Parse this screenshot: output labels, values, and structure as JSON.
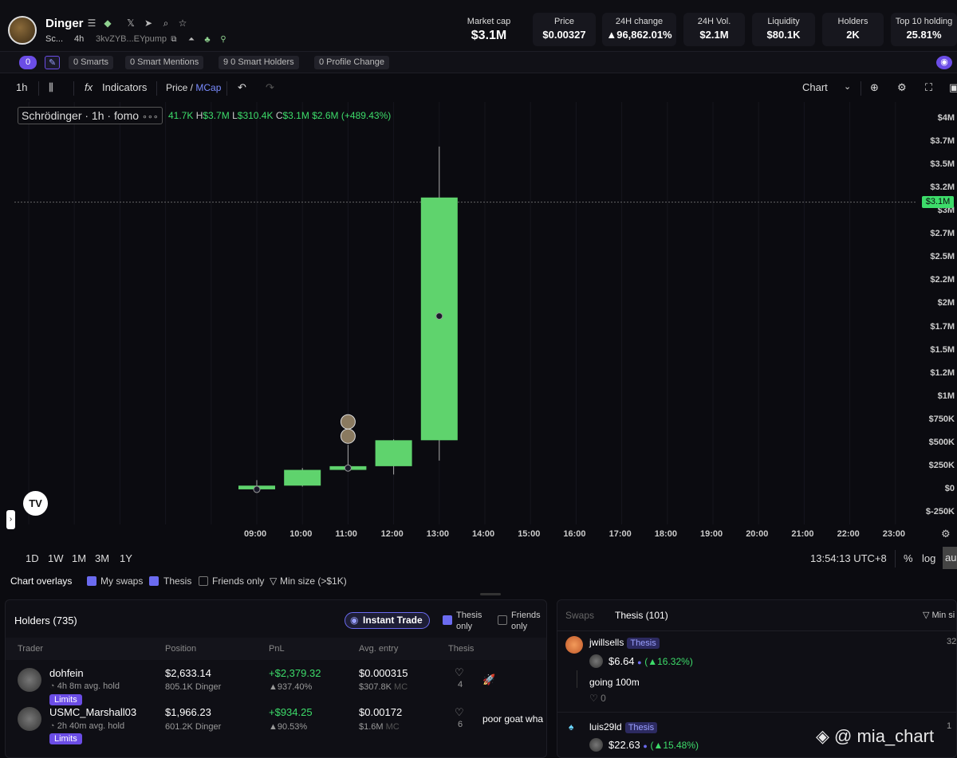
{
  "token": {
    "name": "Dinger",
    "symbol_short": "Sc...",
    "age": "4h",
    "address": "3kvZYB...EYpump"
  },
  "stats": [
    {
      "label": "Market cap",
      "value": "$3.1M"
    },
    {
      "label": "Price",
      "value": "$0.00327"
    },
    {
      "label": "24H change",
      "value": "▲96,862.01%"
    },
    {
      "label": "24H Vol.",
      "value": "$2.1M"
    },
    {
      "label": "Liquidity",
      "value": "$80.1K"
    },
    {
      "label": "Holders",
      "value": "2K"
    },
    {
      "label": "Top 10 holding",
      "value": "25.81%"
    }
  ],
  "filter_chips": {
    "count0": "0",
    "smarts": "0  Smarts",
    "smart_mentions": "0  Smart Mentions",
    "smart_holders": "9 0  Smart Holders",
    "profile_change": "0  Profile Change"
  },
  "toolbar": {
    "interval": "1h",
    "indicators": "Indicators",
    "price": "Price",
    "slash": " / ",
    "mcap": "MCap",
    "chart_type": "Chart"
  },
  "legend": {
    "title": "Schrödinger · 1h · fomo",
    "dots": "∘∘∘",
    "open": "41.7K",
    "h_label": "H",
    "high": "$3.7M",
    "l_label": "L",
    "low": "$310.4K",
    "c_label": "C",
    "close": "$3.1M",
    "change": "$2.6M (+489.43%)"
  },
  "chart_data": {
    "type": "candlestick",
    "x": [
      "09:00",
      "10:00",
      "11:00",
      "12:00",
      "13:00",
      "14:00",
      "15:00",
      "16:00",
      "17:00",
      "18:00",
      "19:00",
      "20:00",
      "21:00",
      "22:00",
      "23:00"
    ],
    "yticks": [
      "$4M",
      "$3.7M",
      "$3.5M",
      "$3.2M",
      "$3M",
      "$2.7M",
      "$2.5M",
      "$2.2M",
      "$2M",
      "$1.7M",
      "$1.5M",
      "$1.2M",
      "$1M",
      "$750K",
      "$500K",
      "$250K",
      "$0",
      "$-250K"
    ],
    "ylim": [
      -250000,
      4000000
    ],
    "candles": [
      {
        "t": "09:00",
        "open": 0,
        "close": 40000,
        "high": 100000,
        "low": -10000
      },
      {
        "t": "10:00",
        "open": 40000,
        "close": 210000,
        "high": 230000,
        "low": 30000
      },
      {
        "t": "11:00",
        "open": 210000,
        "close": 250000,
        "high": 480000,
        "low": 200000
      },
      {
        "t": "12:00",
        "open": 250000,
        "close": 530000,
        "high": 540000,
        "low": 160000
      },
      {
        "t": "13:00",
        "open": 530000,
        "close": 3150000,
        "high": 3700000,
        "low": 310400
      }
    ],
    "current_price": "$3.1M",
    "current_value": 3100000
  },
  "chart_footer": {
    "ranges": [
      "1D",
      "1W",
      "1M",
      "3M",
      "1Y"
    ],
    "time": "13:54:13 UTC+8",
    "pct": "%",
    "log": "log",
    "auto": "au"
  },
  "overlays": {
    "label": "Chart overlays",
    "my_swaps": "My swaps",
    "thesis": "Thesis",
    "friends_only": "Friends only",
    "min_size": "Min size (>$1K)"
  },
  "holders": {
    "title": "Holders (735)",
    "instant_trade": "Instant Trade",
    "thesis_only": "Thesis only",
    "friends_only": "Friends only",
    "cols": [
      "Trader",
      "Position",
      "PnL",
      "Avg. entry",
      "Thesis"
    ],
    "rows": [
      {
        "name": "dohfein",
        "hold": "4h 8m avg. hold",
        "badge": "Limits",
        "position": "$2,633.14",
        "amount": "805.1K Dinger",
        "pnl": "+$2,379.32",
        "pnl_pct": "▲937.40%",
        "entry": "$0.000315",
        "entry_mc": "$307.8K",
        "mc": "MC",
        "likes": "4",
        "thesis": "🚀"
      },
      {
        "name": "USMC_Marshall03",
        "hold": "2h 40m avg. hold",
        "badge": "Limits",
        "position": "$1,966.23",
        "amount": "601.2K Dinger",
        "pnl": "+$934.25",
        "pnl_pct": "▲90.53%",
        "entry": "$0.00172",
        "entry_mc": "$1.6M",
        "mc": "MC",
        "likes": "6",
        "thesis": "poor goat wha"
      }
    ]
  },
  "thesis_panel": {
    "tab_swaps": "Swaps",
    "tab_thesis": "Thesis (101)",
    "min_size": "Min si",
    "posts": [
      {
        "user": "jwillsells",
        "tag": "Thesis",
        "amount": "$6.64",
        "change": "▲16.32%",
        "text": "going 100m",
        "likes": "0",
        "side": "32"
      },
      {
        "user": "luis29ld",
        "tag": "Thesis",
        "amount": "$22.63",
        "change": "▲15.48%",
        "side": "1"
      }
    ]
  },
  "watermark": "@ mia_chart"
}
